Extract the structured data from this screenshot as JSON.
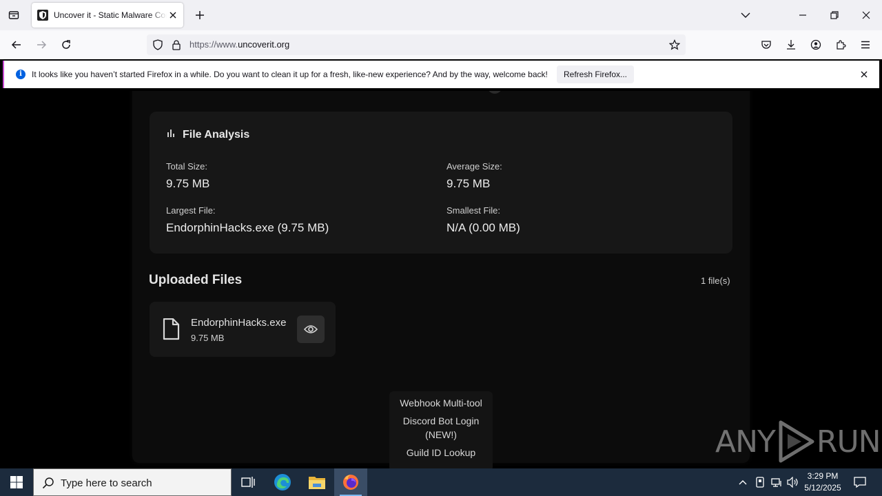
{
  "browser": {
    "tab_title": "Uncover it - Static Malware Control",
    "url_prefix": "https://www.",
    "url_domain": "uncoverit.org",
    "notification": {
      "message": "It looks like you haven’t started Firefox in a while. Do you want to clean it up for a fresh, like-new experience? And by the way, welcome back!",
      "button_label": "Refresh Firefox..."
    }
  },
  "analysis": {
    "title": "File Analysis",
    "total_size_label": "Total Size:",
    "total_size_value": "9.75 MB",
    "average_size_label": "Average Size:",
    "average_size_value": "9.75 MB",
    "largest_file_label": "Largest File:",
    "largest_file_value": "EndorphinHacks.exe (9.75 MB)",
    "smallest_file_label": "Smallest File:",
    "smallest_file_value": "N/A (0.00 MB)"
  },
  "uploaded": {
    "title": "Uploaded Files",
    "count": "1 file(s)",
    "files": [
      {
        "name": "EndorphinHacks.exe",
        "size": "9.75 MB"
      }
    ]
  },
  "tools_menu": {
    "items": [
      "Webhook Multi-tool",
      "Discord Bot Login",
      "(NEW!)",
      "Guild ID Lookup"
    ]
  },
  "watermark": "ANY RUN",
  "taskbar": {
    "search_placeholder": "Type here to search",
    "time": "3:29 PM",
    "date": "5/12/2025"
  }
}
